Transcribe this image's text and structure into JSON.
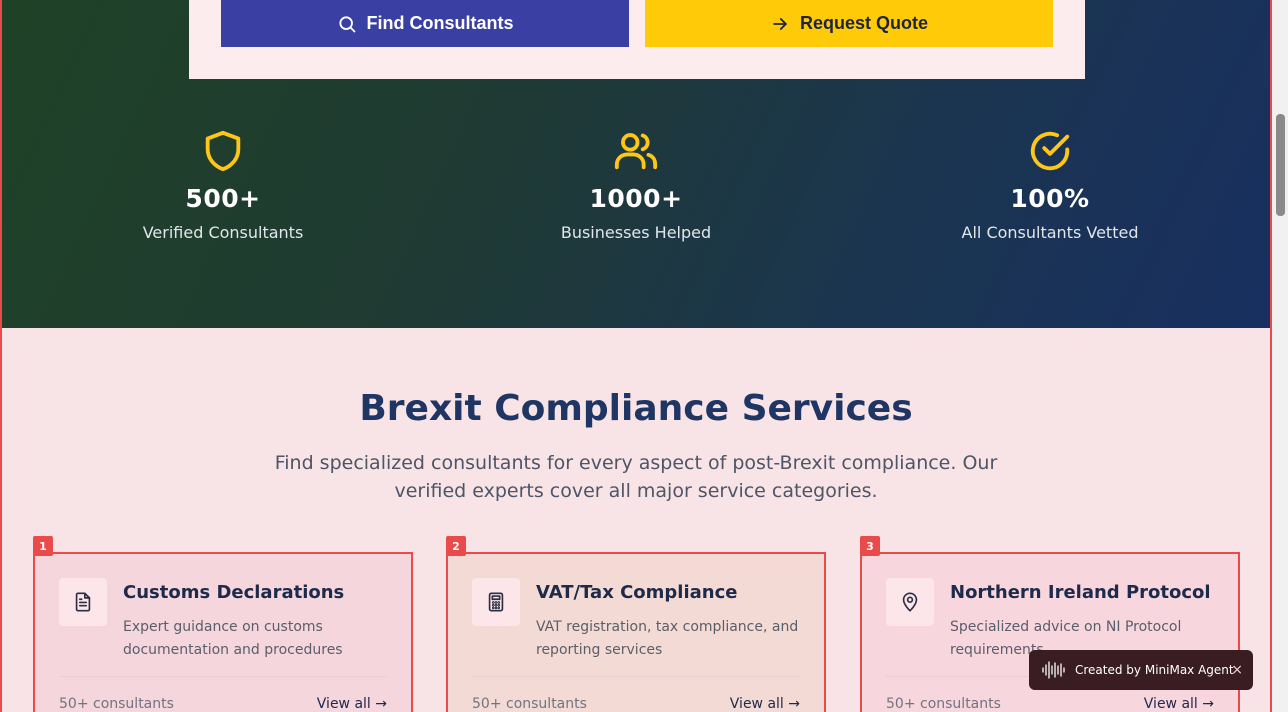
{
  "hero": {
    "find_button": "Find Consultants",
    "quote_button": "Request Quote"
  },
  "stats": [
    {
      "icon": "shield-icon",
      "value": "500+",
      "label": "Verified Consultants"
    },
    {
      "icon": "users-icon",
      "value": "1000+",
      "label": "Businesses Helped"
    },
    {
      "icon": "check-circle-icon",
      "value": "100%",
      "label": "All Consultants Vetted"
    }
  ],
  "services": {
    "title": "Brexit Compliance Services",
    "subtitle": "Find specialized consultants for every aspect of post-Brexit compliance. Our verified experts cover all major service categories.",
    "cards": [
      {
        "badge": "1",
        "icon": "document-icon",
        "title": "Customs Declarations",
        "description": "Expert guidance on customs documentation and procedures",
        "count": "50+ consultants",
        "link": "View all →"
      },
      {
        "badge": "2",
        "icon": "calculator-icon",
        "title": "VAT/Tax Compliance",
        "description": "VAT registration, tax compliance, and reporting services",
        "count": "50+ consultants",
        "link": "View all →"
      },
      {
        "badge": "3",
        "icon": "map-pin-icon",
        "title": "Northern Ireland Protocol",
        "description": "Specialized advice on NI Protocol requirements",
        "count": "50+ consultants",
        "link": "View all →"
      }
    ]
  },
  "toast": {
    "text": "Created by MiniMax Agent",
    "close": "×"
  },
  "colors": {
    "accent_yellow": "#ffca08",
    "primary_indigo": "#3a3fa3",
    "title_navy": "#1f3563",
    "highlight_red": "#e94b4b"
  }
}
